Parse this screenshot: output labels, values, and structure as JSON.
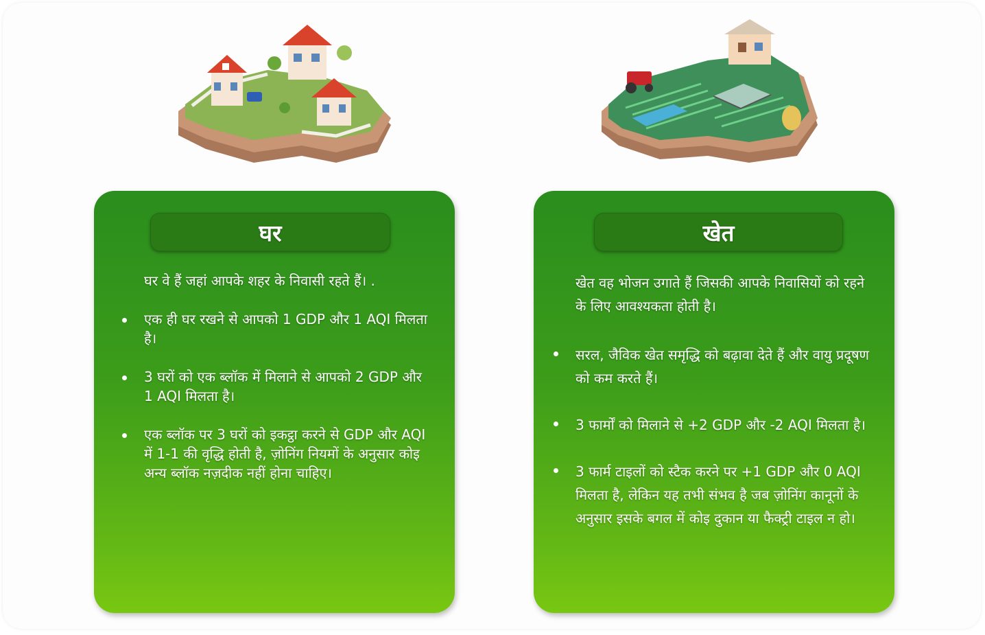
{
  "cards": {
    "home": {
      "title": "घर",
      "intro": "घर वे हैं जहां आपके शहर के निवासी रहते हैं। .",
      "bullets": [
        "एक ही घर रखने से आपको 1 GDP और 1 AQI मिलता है।",
        "3 घरों को एक ब्लॉक में मिलाने से आपको 2 GDP और 1 AQI मिलता है।",
        "एक ब्लॉक पर 3 घरों को इकट्ठा करने से GDP और AQI में 1-1 की वृद्धि होती है, ज़ोनिंग नियमों के अनुसार कोइ अन्य ब्लॉक नज़दीक नहीं होना चाहिए।"
      ]
    },
    "farm": {
      "title": "खेत",
      "intro": "खेत वह भोजन उगाते हैं जिसकी आपके निवासियों को रहने के लिए आवश्यकता होती है।",
      "bullets": [
        "सरल, जैविक खेत समृद्धि को बढ़ावा देते हैं और वायु प्रदूषण को कम करते हैं।",
        "3 फार्मों को मिलाने से +2 GDP और -2 AQI मिलता है।",
        "3 फार्म टाइलों को स्टैक करने पर +1 GDP और 0 AQI मिलता है, लेकिन यह तभी संभव है जब ज़ोनिंग कानूनों के अनुसार इसके बगल में कोइ दुकान या फैक्ट्री टाइल न हो।"
      ]
    }
  },
  "colors": {
    "card_top": "#2a8d1d",
    "card_bottom": "#78c712",
    "title_bar": "#2a7a16"
  },
  "icons": {
    "home": "houses-tile-illustration",
    "farm": "farm-tile-illustration"
  }
}
